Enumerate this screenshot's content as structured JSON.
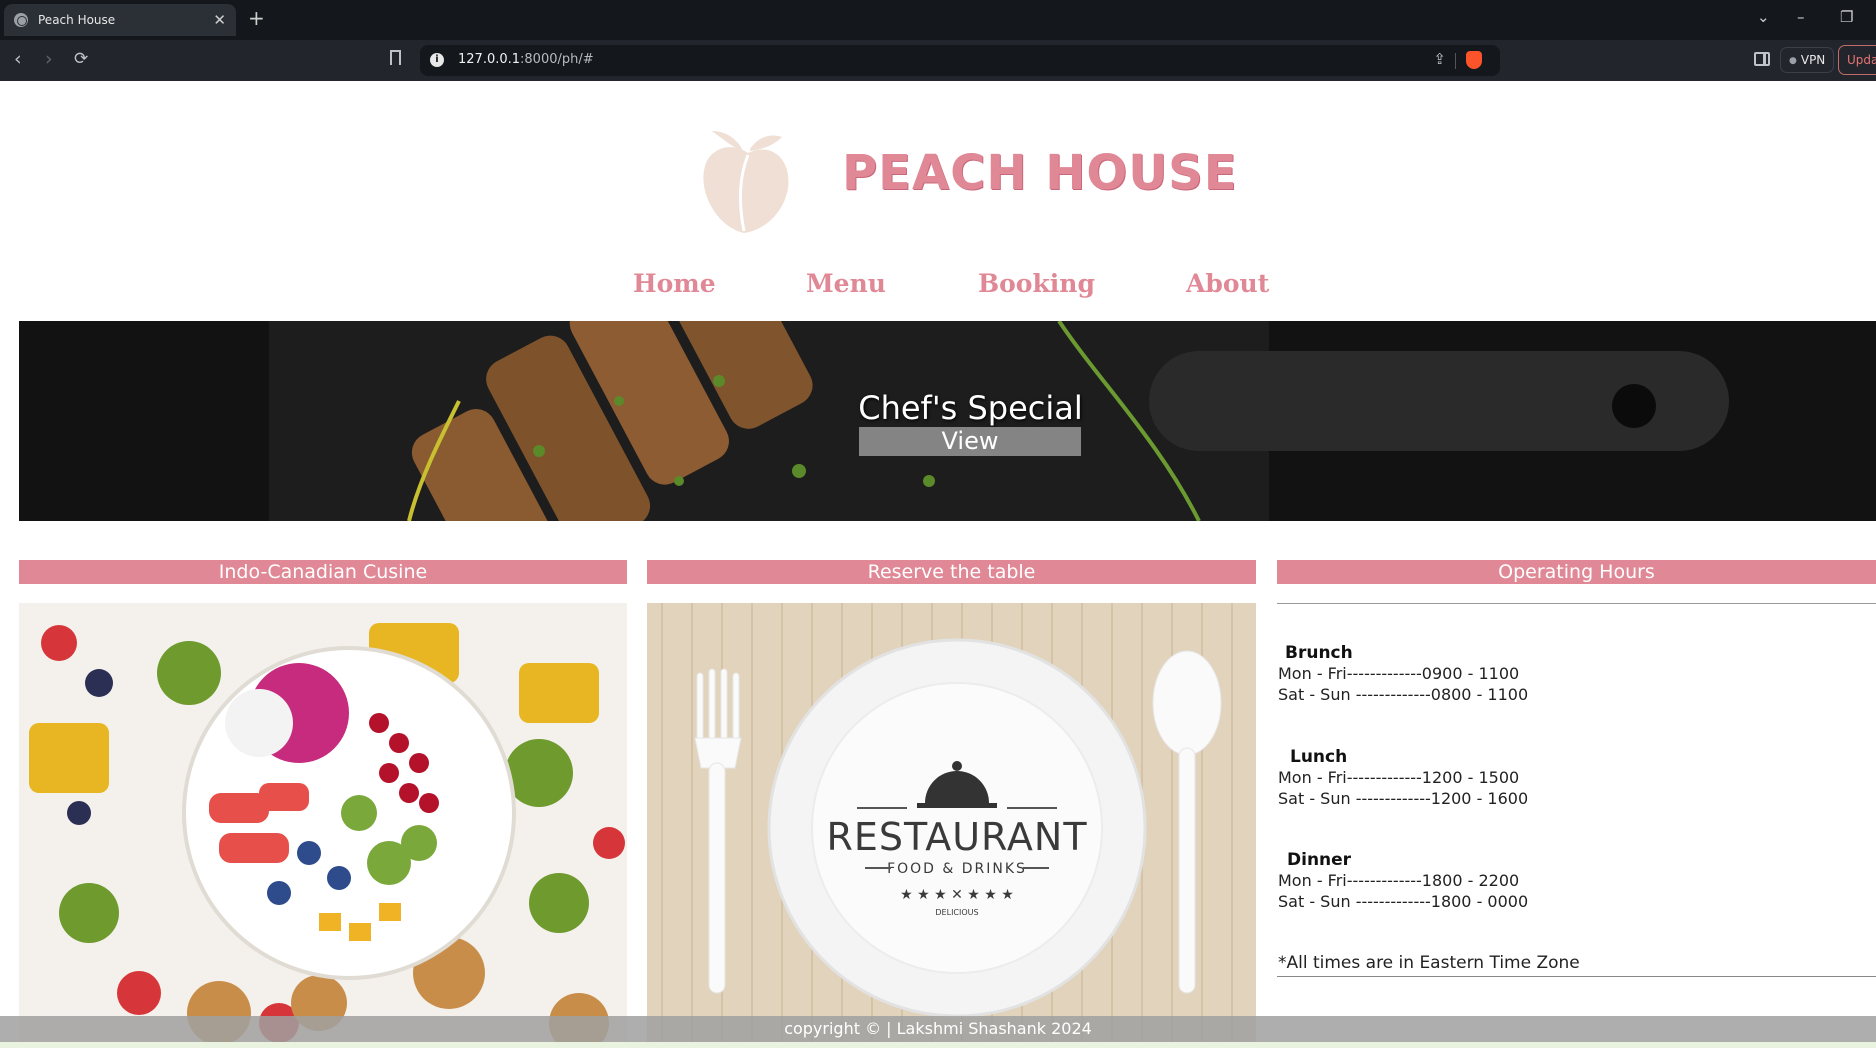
{
  "browser": {
    "tab_title": "Peach House",
    "tab_close": "✕",
    "new_tab": "+",
    "url_host": "127.0.0.1",
    "url_path": ":8000/ph/#",
    "vpn_label": "VPN",
    "update_label": "Update"
  },
  "site": {
    "brand": "PEACH HOUSE",
    "nav": [
      "Home",
      "Menu",
      "Booking",
      "About"
    ],
    "hero": {
      "title": "Chef's Special",
      "button": "View"
    },
    "columns": {
      "cuisine": "Indo-Canadian Cusine",
      "reserve": "Reserve the table",
      "hours": "Operating Hours"
    },
    "plate": {
      "brand": "RESTAURANT",
      "sub": "FOOD & DRINKS",
      "tag": "DELICIOUS"
    },
    "hours": {
      "brunch": {
        "title": "Brunch",
        "weekday": "Mon - Fri-------------0900 - 1100",
        "weekend": "Sat - Sun -------------0800 - 1100"
      },
      "lunch": {
        "title": "Lunch",
        "weekday": "Mon - Fri-------------1200 - 1500",
        "weekend": "Sat - Sun -------------1200 - 1600"
      },
      "dinner": {
        "title": "Dinner",
        "weekday": "Mon - Fri-------------1800 - 2200",
        "weekend": "Sat - Sun -------------1800 - 0000"
      },
      "note": "*All times are in Eastern Time Zone"
    },
    "footer": "copyright © | Lakshmi Shashank 2024"
  },
  "colors": {
    "accent": "#e08896",
    "peach": "#f0e0d6",
    "chrome_dark": "#14171c"
  }
}
